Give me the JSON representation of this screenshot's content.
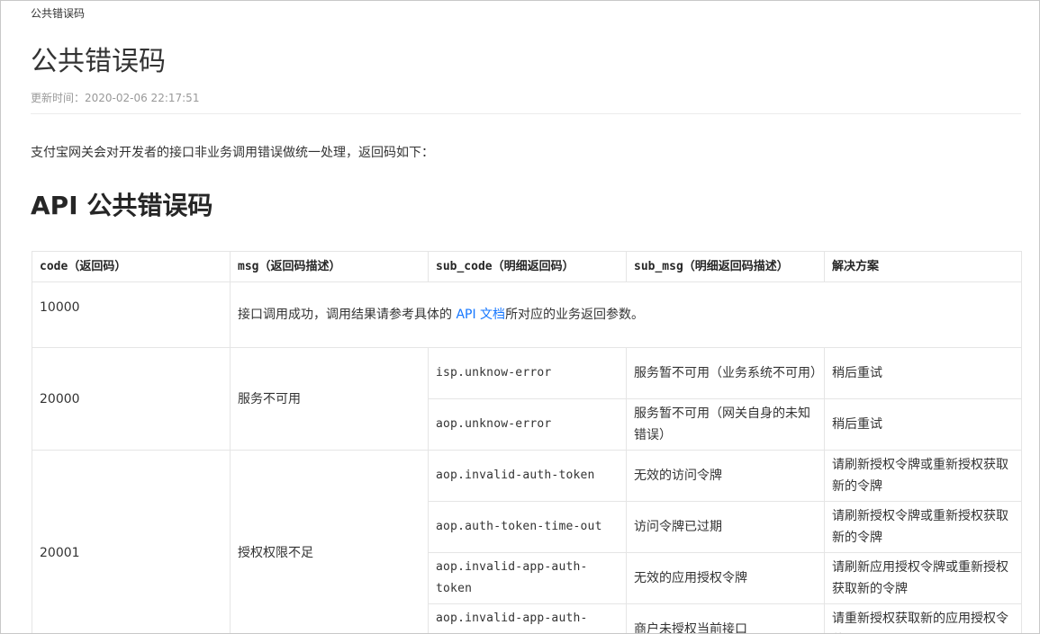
{
  "page": {
    "breadcrumb": "公共错误码",
    "title": "公共错误码",
    "updated": "更新时间：2020-02-06 22:17:51",
    "intro": "支付宝网关会对开发者的接口非业务调用错误做统一处理，返回码如下：",
    "section_title": "API 公共错误码"
  },
  "table": {
    "headers": [
      {
        "code": "code",
        "cn": "（返回码）"
      },
      {
        "code": "msg",
        "cn": "（返回码描述）"
      },
      {
        "code": "sub_code",
        "cn": "（明细返回码）"
      },
      {
        "code": "sub_msg",
        "cn": "（明细返回码描述）"
      },
      {
        "code": "",
        "cn": "解决方案"
      }
    ],
    "success": {
      "code": "10000",
      "msg_prefix": "接口调用成功，调用结果请参考具体的 ",
      "link_text": "API 文档",
      "msg_suffix": "所对应的业务返回参数。"
    },
    "group_20000": {
      "code": "20000",
      "msg": "服务不可用",
      "rows": [
        {
          "sub_code": "isp.unknow-error",
          "sub_msg": "服务暂不可用（业务系统不可用）",
          "solution": "稍后重试"
        },
        {
          "sub_code": "aop.unknow-error",
          "sub_msg": "服务暂不可用（网关自身的未知错误）",
          "solution": "稍后重试"
        }
      ]
    },
    "group_20001": {
      "code": "20001",
      "msg": "授权权限不足",
      "rows": [
        {
          "sub_code": "aop.invalid-auth-token",
          "sub_msg": "无效的访问令牌",
          "solution": "请刷新授权令牌或重新授权获取新的令牌"
        },
        {
          "sub_code": "aop.auth-token-time-out",
          "sub_msg": "访问令牌已过期",
          "solution": "请刷新授权令牌或重新授权获取新的令牌"
        },
        {
          "sub_code": "aop.invalid-app-auth-token",
          "sub_msg": "无效的应用授权令牌",
          "solution": "请刷新应用授权令牌或重新授权获取新的令牌"
        },
        {
          "sub_code": "aop.invalid-app-auth-token-no-api",
          "sub_msg": "商户未授权当前接口",
          "solution": "请重新授权获取新的应用授权令牌"
        }
      ]
    }
  }
}
